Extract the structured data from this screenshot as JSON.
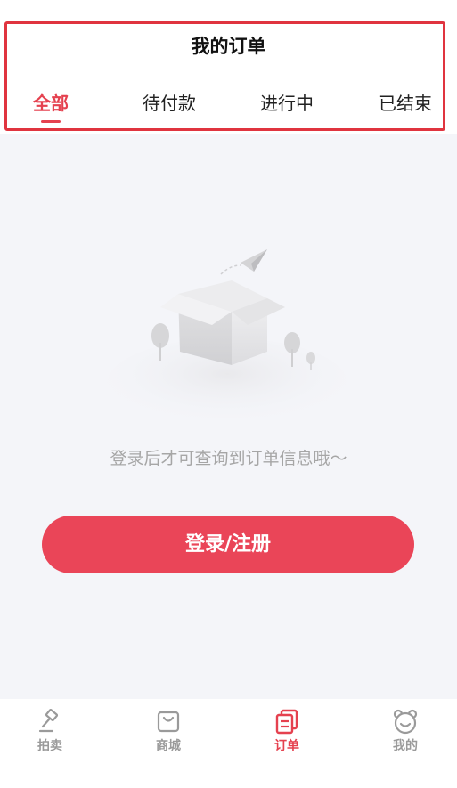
{
  "header": {
    "title": "我的订单",
    "tabs": [
      {
        "label": "全部"
      },
      {
        "label": "待付款"
      },
      {
        "label": "进行中"
      },
      {
        "label": "已结束"
      }
    ],
    "active_tab_index": 0
  },
  "empty_state": {
    "icon": "empty-box-illustration",
    "message": "登录后才可查询到订单信息哦～"
  },
  "login_button": {
    "label": "登录/注册"
  },
  "tabbar": {
    "items": [
      {
        "label": "拍卖",
        "icon": "gavel-icon"
      },
      {
        "label": "商城",
        "icon": "shopping-bag-icon"
      },
      {
        "label": "订单",
        "icon": "order-list-icon"
      },
      {
        "label": "我的",
        "icon": "bear-face-icon"
      }
    ],
    "active_index": 2
  },
  "colors": {
    "accent": "#e5414f",
    "button": "#ea4558",
    "highlight_border": "#e0343f",
    "background": "#f4f5f9"
  }
}
